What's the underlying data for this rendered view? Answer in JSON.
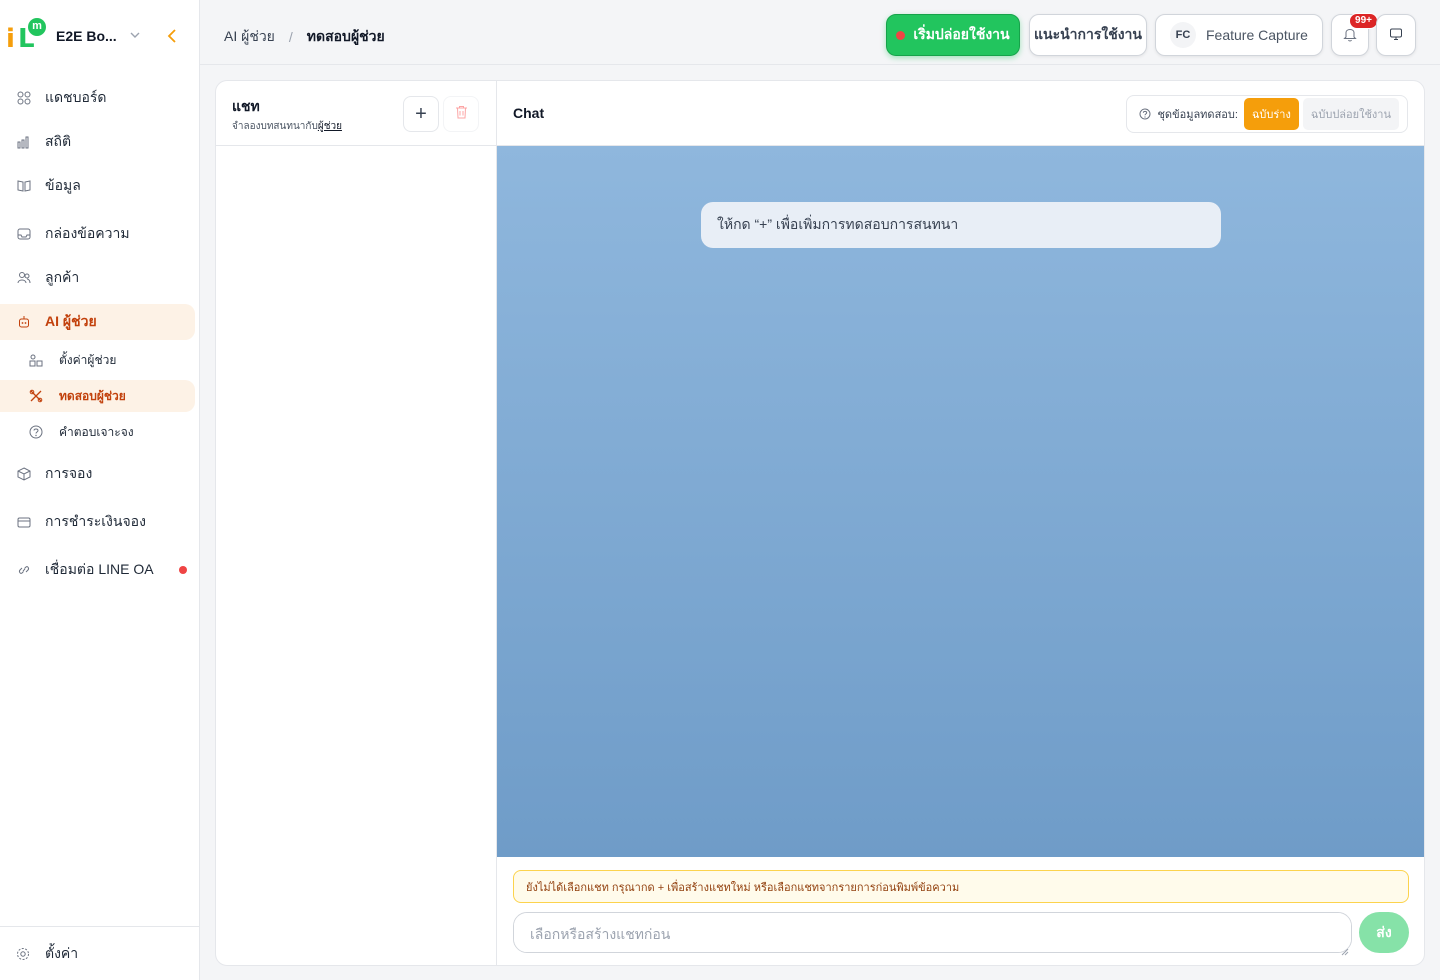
{
  "sidebar": {
    "workspace_name": "E2E Bo...",
    "items": [
      {
        "label": "แดชบอร์ด"
      },
      {
        "label": "สถิติ"
      },
      {
        "label": "ข้อมูล"
      },
      {
        "label": "กล่องข้อความ"
      },
      {
        "label": "ลูกค้า"
      },
      {
        "label": "AI ผู้ช่วย"
      },
      {
        "label": "ตั้งค่าผู้ช่วย"
      },
      {
        "label": "ทดสอบผู้ช่วย"
      },
      {
        "label": "คำตอบเจาะจง"
      },
      {
        "label": "การจอง"
      },
      {
        "label": "การชำระเงินจอง"
      },
      {
        "label": "เชื่อมต่อ LINE OA"
      }
    ],
    "footer_label": "ตั้งค่า",
    "accent_color": "#f59e0b"
  },
  "topbar": {
    "breadcrumb_parent": "AI ผู้ช่วย",
    "breadcrumb_sep": "/",
    "breadcrumb_current": "ทดสอบผู้ช่วย",
    "launch_label": "เริ่มปล่อยใช้งาน",
    "guide_label": "แนะนำการใช้งาน",
    "fc_initials": "FC",
    "fc_label": "Feature Capture",
    "notif_badge": "99+"
  },
  "chatlist": {
    "title": "แชท",
    "subtitle_prefix": "จำลองบทสนทนากับ",
    "subtitle_link": "ผู้ช่วย",
    "add_label": "+"
  },
  "chat": {
    "title": "Chat",
    "dataset_label": "ชุดข้อมูลทดสอบ:",
    "dataset_draft": "ฉบับร่าง",
    "dataset_prod": "ฉบับปล่อยใช้งาน",
    "hint": "ให้กด “+” เพื่อเพิ่มการทดสอบการสนทนา",
    "warning": "ยังไม่ได้เลือกแชท กรุณากด + เพื่อสร้างแชทใหม่ หรือเลือกแชทจากรายการก่อนพิมพ์ข้อความ",
    "input_placeholder": "เลือกหรือสร้างแชทก่อน",
    "send_label": "ส่ง"
  }
}
